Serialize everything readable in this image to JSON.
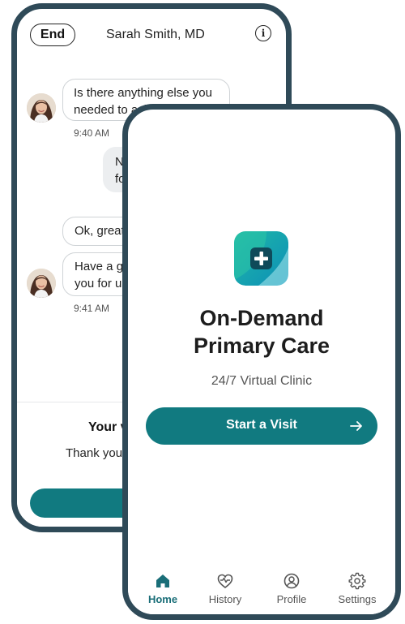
{
  "chat": {
    "end_label": "End",
    "doctor_name": "Sarah Smith, MD",
    "messages": [
      {
        "from": "doctor",
        "text": "Is there anything else you needed to ask me about?",
        "line1": "Is there anything else you",
        "line2": "needed to ask me about?",
        "time": "9:40 AM"
      },
      {
        "from": "me",
        "line1": "No",
        "line2": "for"
      },
      {
        "from": "doctor",
        "line1": "Ok, great."
      },
      {
        "from": "doctor",
        "line1": "Have a gr",
        "line2": "you for us",
        "time": "9:41 AM"
      }
    ],
    "feedback": {
      "title": "Your v",
      "text": "Thank you",
      "button_label": "L"
    }
  },
  "home": {
    "title_line1": "On-Demand",
    "title_line2": "Primary Care",
    "subtitle": "24/7 Virtual Clinic",
    "start_label": "Start a Visit",
    "tabs": [
      {
        "label": "Home",
        "icon": "home-icon",
        "active": true
      },
      {
        "label": "History",
        "icon": "heart-icon",
        "active": false
      },
      {
        "label": "Profile",
        "icon": "profile-icon",
        "active": false
      },
      {
        "label": "Settings",
        "icon": "gear-icon",
        "active": false
      }
    ]
  },
  "colors": {
    "accent": "#117a80",
    "frame": "#2f4a58",
    "active_tab": "#1a6e78"
  }
}
